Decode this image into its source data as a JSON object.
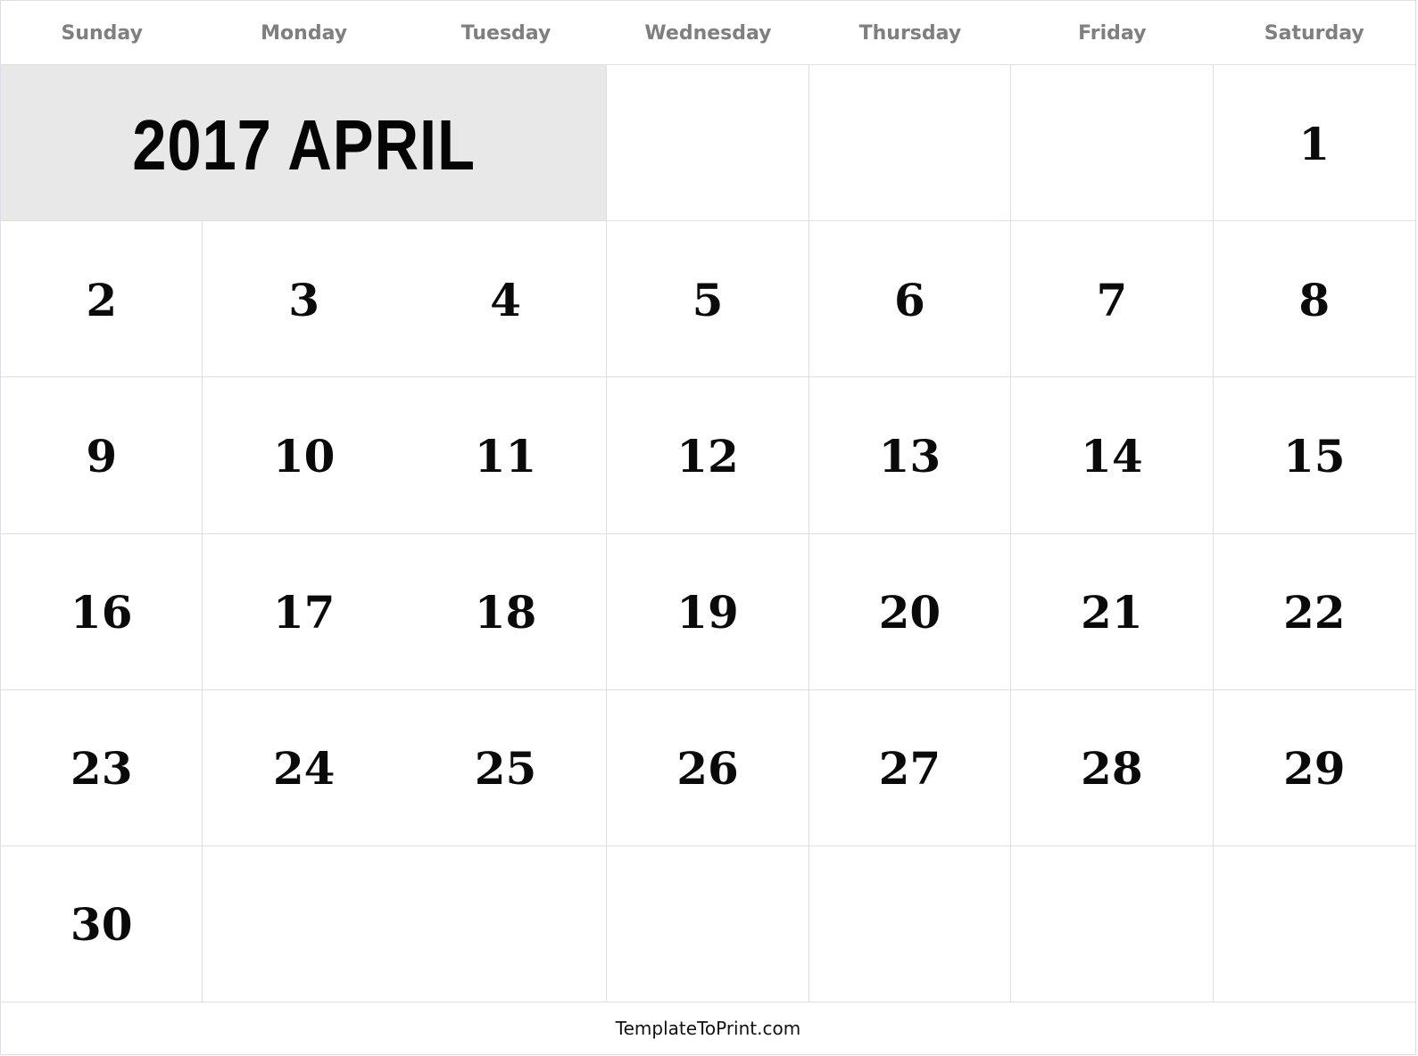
{
  "calendar": {
    "title": "2017 APRIL",
    "weekdays": [
      "Sunday",
      "Monday",
      "Tuesday",
      "Wednesday",
      "Thursday",
      "Friday",
      "Saturday"
    ],
    "leading_blank_after_title": [
      "",
      "",
      ""
    ],
    "days": [
      "1",
      "2",
      "3",
      "4",
      "5",
      "6",
      "7",
      "8",
      "9",
      "10",
      "11",
      "12",
      "13",
      "14",
      "15",
      "16",
      "17",
      "18",
      "19",
      "20",
      "21",
      "22",
      "23",
      "24",
      "25",
      "26",
      "27",
      "28",
      "29",
      "30"
    ],
    "trailing_blanks": [
      "",
      "",
      "",
      "",
      "",
      ""
    ]
  },
  "footer": {
    "text": "TemplateToPrint.com"
  },
  "colors": {
    "title_background": "#e8e8e8",
    "weekday_text": "#7f7f7f",
    "grid_lines": "#dcdfe3",
    "day_number_text": "#0a0a0a"
  }
}
